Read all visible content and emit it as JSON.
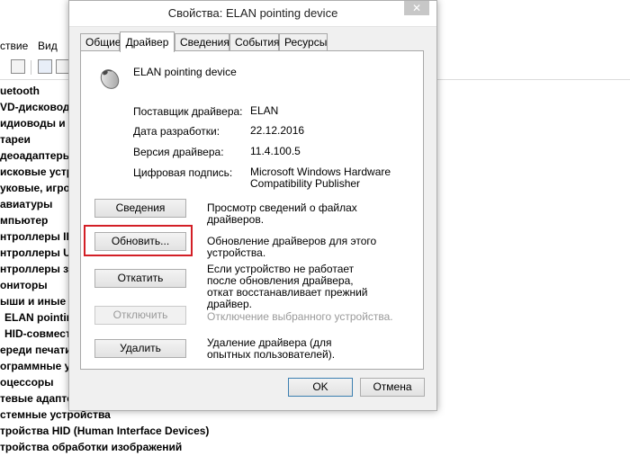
{
  "background": {
    "menu": [
      "ствие",
      "Вид"
    ],
    "tree": [
      {
        "text": "uetooth",
        "bold": true,
        "top": 0
      },
      {
        "text": "VD-дисковод",
        "bold": true
      },
      {
        "text": "идиоводы и а",
        "bold": true
      },
      {
        "text": "тареи",
        "bold": true
      },
      {
        "text": "деоадаптеры",
        "bold": true
      },
      {
        "text": "исковые устро",
        "bold": true
      },
      {
        "text": "уковые, игро",
        "bold": true
      },
      {
        "text": "авиатуры",
        "bold": true
      },
      {
        "text": "мпьютер",
        "bold": true
      },
      {
        "text": "нтроллеры II",
        "bold": true
      },
      {
        "text": "нтроллеры U",
        "bold": true
      },
      {
        "text": "нтроллеры з",
        "bold": true
      },
      {
        "text": "ониторы",
        "bold": true
      },
      {
        "text": "ыши и иные у",
        "bold": true
      },
      {
        "text": "ELAN pointin",
        "bold": true,
        "indent": true
      },
      {
        "text": "HID-совмест",
        "bold": true,
        "indent": true
      },
      {
        "text": "ереди печати",
        "bold": true
      },
      {
        "text": "ограммные у",
        "bold": true
      },
      {
        "text": "оцессоры",
        "bold": true
      },
      {
        "text": "тевые адаптеры",
        "bold": true
      },
      {
        "text": "стемные устройства",
        "bold": true
      },
      {
        "text": "тройства HID (Human Interface Devices)",
        "bold": true
      },
      {
        "text": "тройства обработки изображений",
        "bold": true
      }
    ]
  },
  "dialog": {
    "title": "Свойства: ELAN pointing device",
    "close_label": "✕",
    "tabs": [
      "Общие",
      "Драйвер",
      "Сведения",
      "События",
      "Ресурсы"
    ],
    "active_tab": "Драйвер",
    "device_name": "ELAN pointing device",
    "info": {
      "provider_label": "Поставщик драйвера:",
      "provider_value": "ELAN",
      "date_label": "Дата разработки:",
      "date_value": "22.12.2016",
      "version_label": "Версия драйвера:",
      "version_value": "11.4.100.5",
      "signer_label": "Цифровая подпись:",
      "signer_value": "Microsoft Windows Hardware Compatibility Publisher"
    },
    "buttons": {
      "details_label": "Сведения",
      "details_desc": "Просмотр сведений о файлах драйверов.",
      "update_label": "Обновить...",
      "update_desc": "Обновление драйверов для этого устройства.",
      "rollback_label": "Откатить",
      "rollback_desc": "Если устройство не работает после обновления драйвера, откат восстанавливает прежний драйвер.",
      "disable_label": "Отключить",
      "disable_desc": "Отключение выбранного устройства.",
      "uninstall_label": "Удалить",
      "uninstall_desc": "Удаление драйвера (для опытных пользователей)."
    },
    "ok_label": "OK",
    "cancel_label": "Отмена",
    "highlight_color": "#d31f26"
  }
}
